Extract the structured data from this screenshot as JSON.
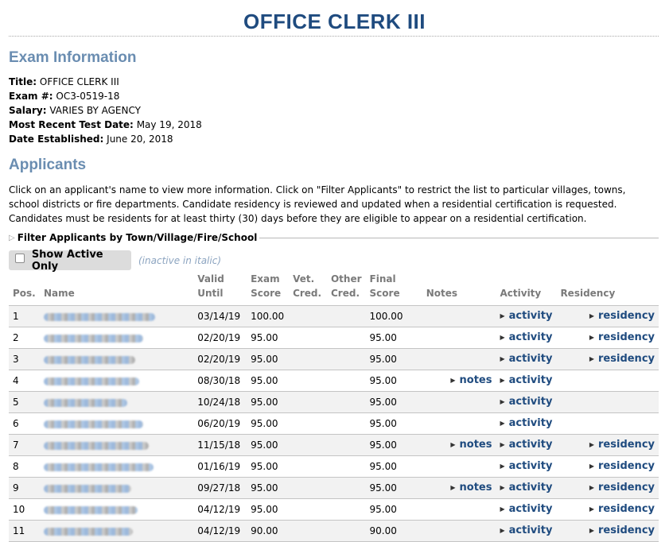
{
  "page": {
    "title": "OFFICE CLERK III"
  },
  "exam_info": {
    "heading": "Exam Information",
    "fields": [
      {
        "label": "Title:",
        "value": "OFFICE CLERK III"
      },
      {
        "label": "Exam #:",
        "value": "OC3-0519-18"
      },
      {
        "label": "Salary:",
        "value": "VARIES BY AGENCY"
      },
      {
        "label": "Most Recent Test Date:",
        "value": "May 19, 2018"
      },
      {
        "label": "Date Established:",
        "value": "June 20, 2018"
      }
    ]
  },
  "applicants": {
    "heading": "Applicants",
    "description": "Click on an applicant's name to view more information. Click on \"Filter Applicants\" to restrict the list to particular villages, towns, school districts or fire departments. Candidate residency is reviewed and updated when a residential certification is requested. Candidates must be residents for at least thirty (30) days before they are eligible to appear on a residential certification.",
    "filter_label": "Filter Applicants by Town/Village/Fire/School",
    "show_active_label": "Show Active Only",
    "inactive_note": "(inactive in italic)",
    "columns": {
      "pos": "Pos.",
      "name": "Name",
      "valid_until": [
        "Valid",
        "Until"
      ],
      "exam_score": [
        "Exam",
        "Score"
      ],
      "vet_cred": [
        "Vet.",
        "Cred."
      ],
      "other_cred": [
        "Other",
        "Cred."
      ],
      "final_score": [
        "Final",
        "Score"
      ],
      "notes": "Notes",
      "activity": "Activity",
      "residency": "Residency"
    },
    "rows": [
      {
        "pos": "1",
        "valid_until": "03/14/19",
        "exam_score": "100.00",
        "final_score": "100.00",
        "notes": "",
        "activity": "activity",
        "residency": "residency"
      },
      {
        "pos": "2",
        "valid_until": "02/20/19",
        "exam_score": "95.00",
        "final_score": "95.00",
        "notes": "",
        "activity": "activity",
        "residency": "residency"
      },
      {
        "pos": "3",
        "valid_until": "02/20/19",
        "exam_score": "95.00",
        "final_score": "95.00",
        "notes": "",
        "activity": "activity",
        "residency": "residency"
      },
      {
        "pos": "4",
        "valid_until": "08/30/18",
        "exam_score": "95.00",
        "final_score": "95.00",
        "notes": "notes",
        "activity": "activity",
        "residency": ""
      },
      {
        "pos": "5",
        "valid_until": "10/24/18",
        "exam_score": "95.00",
        "final_score": "95.00",
        "notes": "",
        "activity": "activity",
        "residency": ""
      },
      {
        "pos": "6",
        "valid_until": "06/20/19",
        "exam_score": "95.00",
        "final_score": "95.00",
        "notes": "",
        "activity": "activity",
        "residency": ""
      },
      {
        "pos": "7",
        "valid_until": "11/15/18",
        "exam_score": "95.00",
        "final_score": "95.00",
        "notes": "notes",
        "activity": "activity",
        "residency": "residency"
      },
      {
        "pos": "8",
        "valid_until": "01/16/19",
        "exam_score": "95.00",
        "final_score": "95.00",
        "notes": "",
        "activity": "activity",
        "residency": "residency"
      },
      {
        "pos": "9",
        "valid_until": "09/27/18",
        "exam_score": "95.00",
        "final_score": "95.00",
        "notes": "notes",
        "activity": "activity",
        "residency": "residency"
      },
      {
        "pos": "10",
        "valid_until": "04/12/19",
        "exam_score": "95.00",
        "final_score": "95.00",
        "notes": "",
        "activity": "activity",
        "residency": "residency"
      },
      {
        "pos": "11",
        "valid_until": "04/12/19",
        "exam_score": "90.00",
        "final_score": "90.00",
        "notes": "",
        "activity": "activity",
        "residency": "residency"
      }
    ]
  }
}
